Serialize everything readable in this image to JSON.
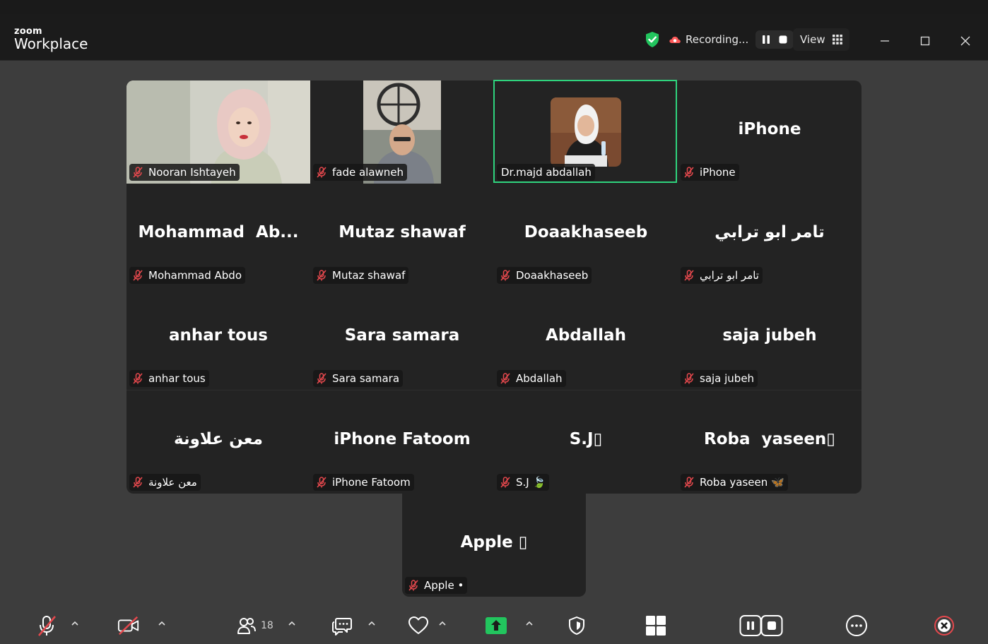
{
  "app": {
    "brand_small": "zoom",
    "brand_big": "Workplace"
  },
  "recording": {
    "label": "Recording..."
  },
  "view": {
    "label": "View"
  },
  "colors": {
    "active_speaker": "#2fd37d",
    "mute_red": "#e5484d",
    "shield_green": "#22c55e",
    "share_green": "#22c55e",
    "end_red": "#e5484d"
  },
  "participants": [
    {
      "tile_name": "",
      "label": "Nooran Ishtayeh",
      "has_video": true
    },
    {
      "tile_name": "",
      "label": "fade alawneh",
      "has_video": true
    },
    {
      "tile_name": "",
      "label": "Dr.majd abdallah",
      "has_video": true,
      "active": true
    },
    {
      "tile_name": "iPhone",
      "label": "iPhone"
    },
    {
      "tile_name": "Mohammad  Ab...",
      "label": "Mohammad Abdo"
    },
    {
      "tile_name": "Mutaz shawaf",
      "label": "Mutaz shawaf"
    },
    {
      "tile_name": "Doaakhaseeb",
      "label": "Doaakhaseeb"
    },
    {
      "tile_name": "تامر ابو ترابي",
      "label": "تامر ابو ترابي"
    },
    {
      "tile_name": "anhar tous",
      "label": "anhar tous"
    },
    {
      "tile_name": "Sara samara",
      "label": "Sara samara"
    },
    {
      "tile_name": "Abdallah",
      "label": "Abdallah"
    },
    {
      "tile_name": "saja jubeh",
      "label": "saja jubeh"
    },
    {
      "tile_name": "معن علاونة",
      "label": "معن علاونة"
    },
    {
      "tile_name": "iPhone Fatoom",
      "label": "iPhone Fatoom"
    },
    {
      "tile_name": "S.J▯",
      "label": "S.J 🍃"
    },
    {
      "tile_name": "Roba  yaseen▯",
      "label": "Roba yaseen 🦋"
    }
  ],
  "overflow_participant": {
    "tile_name": "Apple ▯",
    "label": "Apple •"
  },
  "toolbar": {
    "participants_count": "18"
  }
}
